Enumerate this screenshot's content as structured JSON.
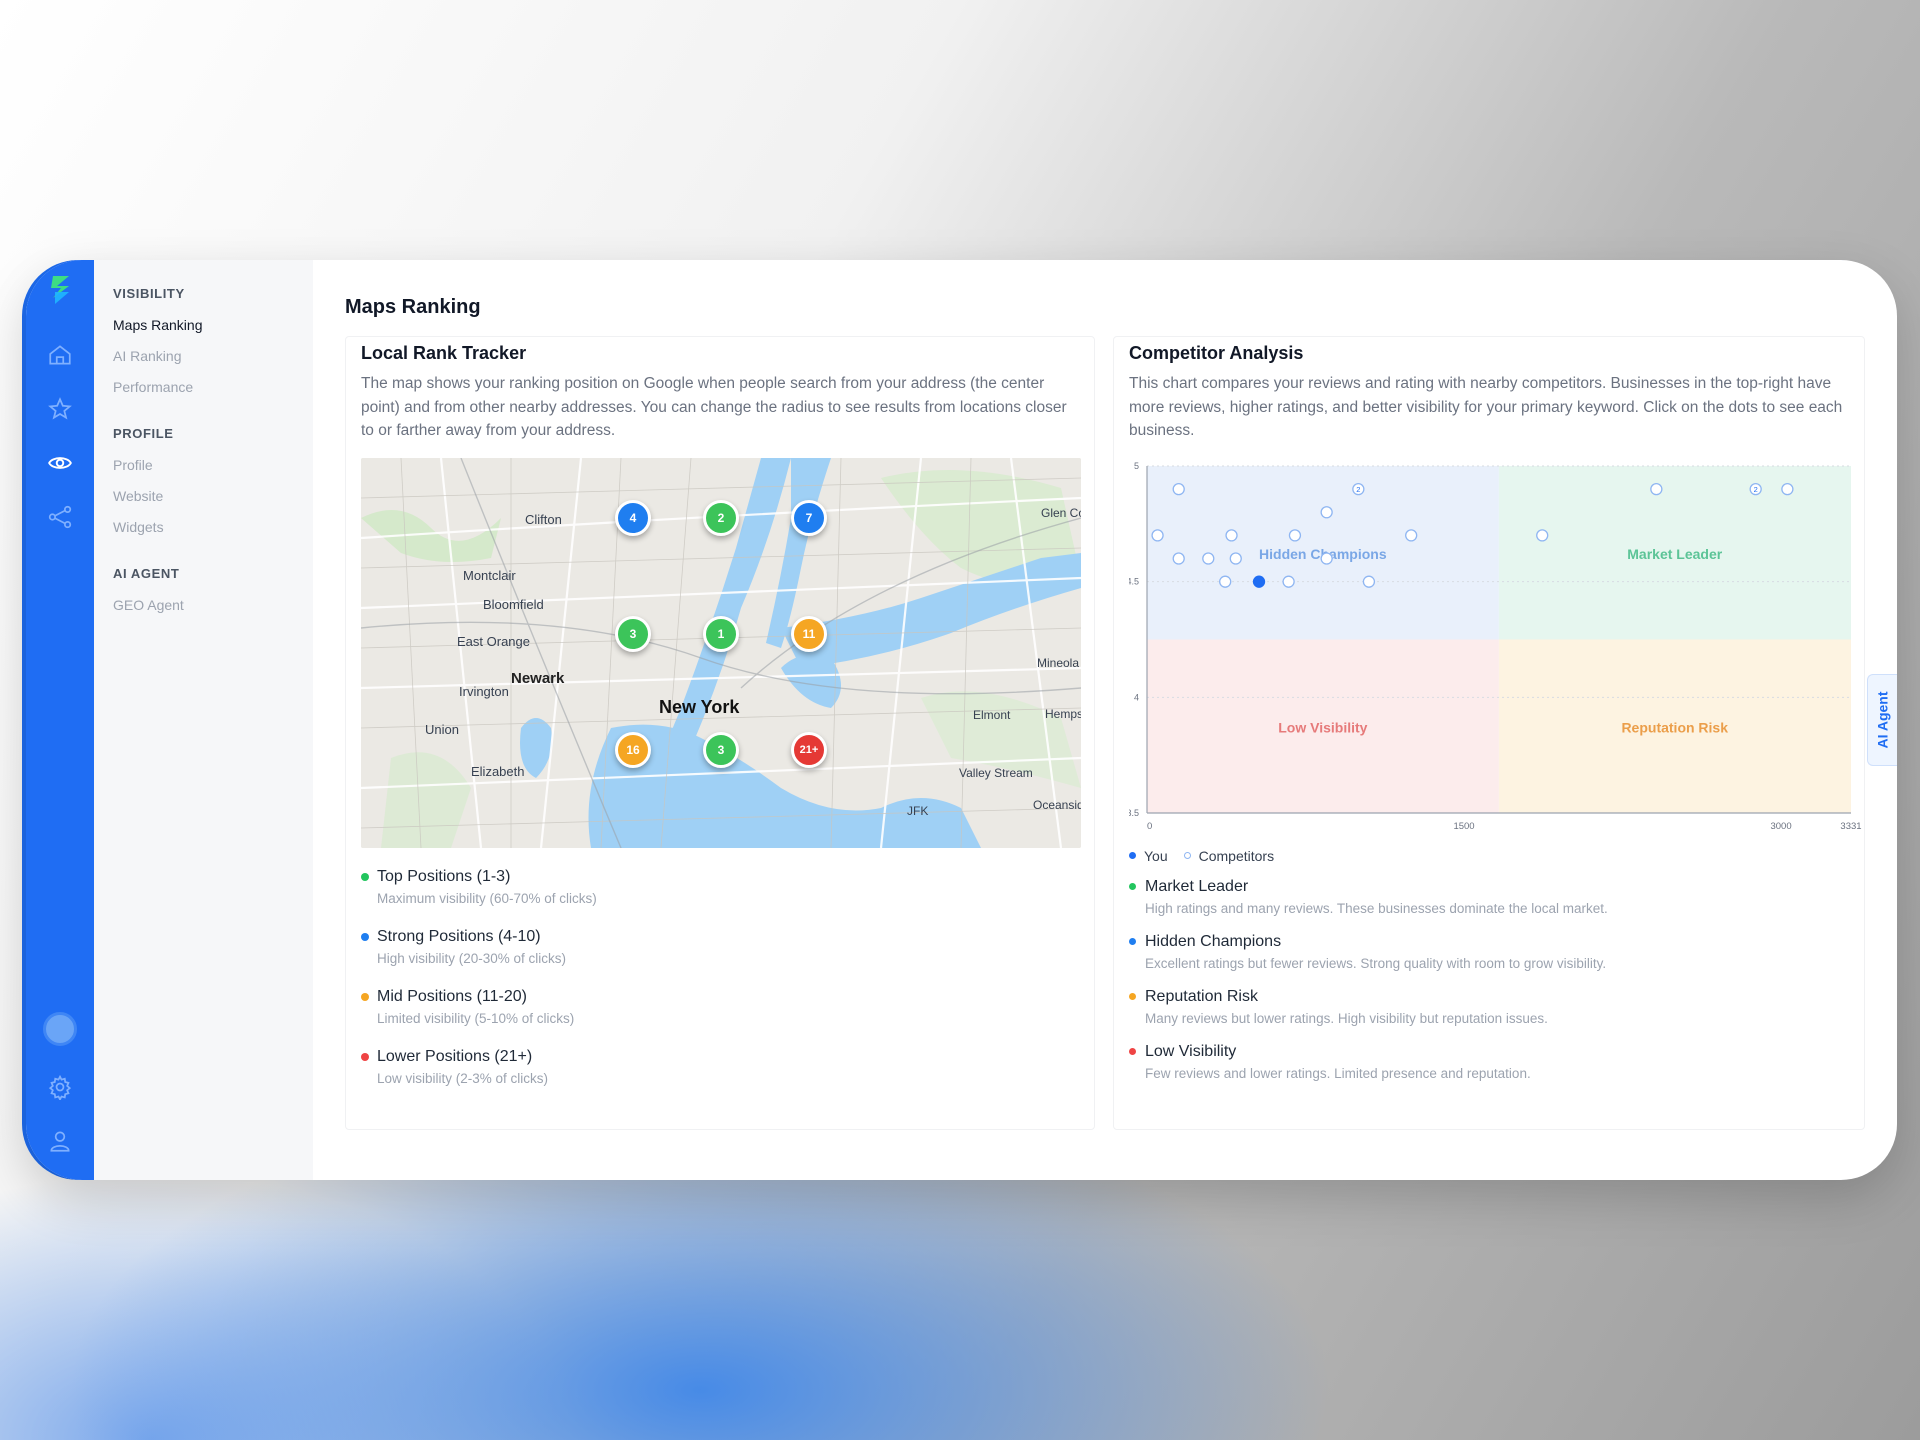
{
  "nav": {
    "sections": [
      {
        "title": "VISIBILITY",
        "items": [
          "Maps Ranking",
          "AI Ranking",
          "Performance"
        ]
      },
      {
        "title": "PROFILE",
        "items": [
          "Profile",
          "Website",
          "Widgets"
        ]
      },
      {
        "title": "AI AGENT",
        "items": [
          "GEO Agent"
        ]
      }
    ],
    "active": "Maps Ranking"
  },
  "page": {
    "title": "Maps Ranking"
  },
  "local_rank": {
    "title": "Local Rank Tracker",
    "description": "The map shows your ranking position on Google when people search from your address (the center point) and from other nearby addresses. You can change the radius to see results from locations closer to or farther away from your address.",
    "map_labels": [
      "Clifton",
      "Montclair",
      "Bloomfield",
      "East Orange",
      "Newark",
      "Irvington",
      "Union",
      "Elizabeth",
      "New York",
      "Glen Co",
      "Mineola",
      "Elmont",
      "Hemps",
      "Valley Stream",
      "Oceansid",
      "JFK"
    ],
    "pins": [
      {
        "rank": "4",
        "color": "#1f7ef0"
      },
      {
        "rank": "2",
        "color": "#3cc45a"
      },
      {
        "rank": "7",
        "color": "#1f7ef0"
      },
      {
        "rank": "3",
        "color": "#3cc45a"
      },
      {
        "rank": "1",
        "color": "#3cc45a"
      },
      {
        "rank": "11",
        "color": "#f5a623"
      },
      {
        "rank": "16",
        "color": "#f5a623"
      },
      {
        "rank": "3",
        "color": "#3cc45a"
      },
      {
        "rank": "21+",
        "color": "#e53935"
      }
    ],
    "legend": [
      {
        "title": "Top Positions (1-3)",
        "sub": "Maximum visibility (60-70% of clicks)",
        "color": "#22c55e"
      },
      {
        "title": "Strong Positions (4-10)",
        "sub": "High visibility (20-30% of clicks)",
        "color": "#1f7ef0"
      },
      {
        "title": "Mid Positions (11-20)",
        "sub": "Limited visibility (5-10% of clicks)",
        "color": "#f5a623"
      },
      {
        "title": "Lower Positions (21+)",
        "sub": "Low visibility (2-3% of clicks)",
        "color": "#ef4444"
      }
    ]
  },
  "competitor": {
    "title": "Competitor Analysis",
    "description": "This chart compares your reviews and rating with nearby competitors. Businesses in the top-right have more reviews, higher ratings, and better visibility for your primary keyword. Click on the dots to see each business.",
    "legend_you": "You",
    "legend_competitors": "Competitors",
    "quadrants": [
      {
        "title": "Market Leader",
        "sub": "High ratings and many reviews. These businesses dominate the local market.",
        "color": "#22c55e"
      },
      {
        "title": "Hidden Champions",
        "sub": "Excellent ratings but fewer reviews. Strong quality with room to grow visibility.",
        "color": "#1f7ef0"
      },
      {
        "title": "Reputation Risk",
        "sub": "Many reviews but lower ratings. High visibility but reputation issues.",
        "color": "#f5a623"
      },
      {
        "title": "Low Visibility",
        "sub": "Few reviews and lower ratings. Limited presence and reputation.",
        "color": "#ef4444"
      }
    ]
  },
  "chart_data": {
    "type": "scatter",
    "xlim": [
      0,
      3331
    ],
    "ylim": [
      3.5,
      5
    ],
    "x_ticks": [
      "0",
      "1500",
      "3000",
      "3331"
    ],
    "x_tick_values": [
      0,
      1500,
      3000,
      3331
    ],
    "y_ticks": [
      "5",
      "4.5",
      "4",
      "3.5"
    ],
    "y_tick_values": [
      5,
      4.5,
      4,
      3.5
    ],
    "x_split": 1665,
    "y_split": 4.25,
    "quadrant_labels": [
      {
        "label": "Hidden Champions",
        "x": 832,
        "y": 4.62,
        "color": "#7aa7e6"
      },
      {
        "label": "Market Leader",
        "x": 2497,
        "y": 4.62,
        "color": "#5cc497"
      },
      {
        "label": "Low Visibility",
        "x": 832,
        "y": 3.87,
        "color": "#e67a7a"
      },
      {
        "label": "Reputation Risk",
        "x": 2497,
        "y": 3.87,
        "color": "#eb9e4a"
      }
    ],
    "quadrant_colors": [
      "#e9f0fb",
      "#e6f6ef",
      "#fcecec",
      "#fdf3e1"
    ],
    "series": [
      {
        "name": "Competitors",
        "points": [
          {
            "x": 150,
            "y": 4.9
          },
          {
            "x": 1000,
            "y": 4.9,
            "label": "2"
          },
          {
            "x": 2410,
            "y": 4.9
          },
          {
            "x": 2880,
            "y": 4.9,
            "label": "2"
          },
          {
            "x": 3030,
            "y": 4.9
          },
          {
            "x": 850,
            "y": 4.8
          },
          {
            "x": 50,
            "y": 4.7
          },
          {
            "x": 400,
            "y": 4.7
          },
          {
            "x": 700,
            "y": 4.7
          },
          {
            "x": 1250,
            "y": 4.7
          },
          {
            "x": 1870,
            "y": 4.7
          },
          {
            "x": 150,
            "y": 4.6
          },
          {
            "x": 290,
            "y": 4.6
          },
          {
            "x": 420,
            "y": 4.6
          },
          {
            "x": 850,
            "y": 4.6
          },
          {
            "x": 370,
            "y": 4.5
          },
          {
            "x": 670,
            "y": 4.5
          },
          {
            "x": 1050,
            "y": 4.5
          }
        ]
      },
      {
        "name": "You",
        "points": [
          {
            "x": 530,
            "y": 4.5
          }
        ]
      }
    ]
  }
}
